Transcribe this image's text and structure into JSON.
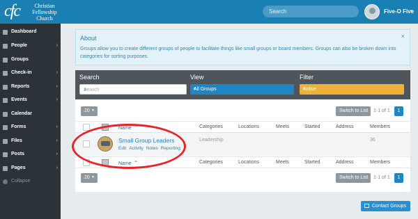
{
  "brand": {
    "mark": "cfc",
    "name_line1": "Christian",
    "name_line2": "Fellowship",
    "name_line3": "Church"
  },
  "topbar": {
    "search_label": "Search",
    "user_name": "Five-O Five",
    "user_caret": "▾"
  },
  "sidebar": {
    "items": [
      {
        "label": "Dashboard",
        "chevron": "",
        "icon": "dashboard-icon"
      },
      {
        "label": "People",
        "chevron": "›",
        "icon": "people-icon"
      },
      {
        "label": "Groups",
        "chevron": "",
        "icon": "groups-icon"
      },
      {
        "label": "Check-in",
        "chevron": "›",
        "icon": "checkin-icon"
      },
      {
        "label": "Reports",
        "chevron": "›",
        "icon": "reports-icon"
      },
      {
        "label": "Events",
        "chevron": "›",
        "icon": "events-icon"
      },
      {
        "label": "Calendar",
        "chevron": "",
        "icon": "calendar-icon"
      },
      {
        "label": "Forms",
        "chevron": "›",
        "icon": "forms-icon"
      },
      {
        "label": "Files",
        "chevron": "›",
        "icon": "files-icon"
      },
      {
        "label": "Posts",
        "chevron": "›",
        "icon": "posts-icon"
      },
      {
        "label": "Pages",
        "chevron": "›",
        "icon": "pages-icon"
      }
    ],
    "collapse_label": "Collapse"
  },
  "about": {
    "title": "About",
    "text": "Groups allow you to create different groups of people to facilitate things like small groups or board members. Groups can also be broken down into categories for sorting purposes.",
    "close": "×"
  },
  "filters": {
    "search_label": "Search",
    "search_placeholder": "Search",
    "view_label": "View",
    "view_value": "All Groups",
    "filter_label": "Filter",
    "filter_value": "Active",
    "dropdown_glyph": "▾",
    "colors": {
      "view_bg": "#1f86c3",
      "filter_bg": "#eeb23a"
    }
  },
  "list": {
    "page_size": "20",
    "switch_label": "Switch to List",
    "range_text": "1-1 of 1",
    "page_number": "1",
    "columns": [
      "Name",
      "Categories",
      "Locations",
      "Meets",
      "Started",
      "Address",
      "Members"
    ],
    "sort_glyph": "⌃",
    "rows": [
      {
        "name": "Small Group Leaders",
        "actions": [
          "Edit",
          "Activity",
          "Notes",
          "Reporting"
        ],
        "category": "Leadership",
        "location": "",
        "meets": "",
        "started": "",
        "address": "",
        "members": "36"
      }
    ]
  },
  "contact_button": {
    "label": "Contact Groups"
  },
  "highlight_color": "#e8232a"
}
